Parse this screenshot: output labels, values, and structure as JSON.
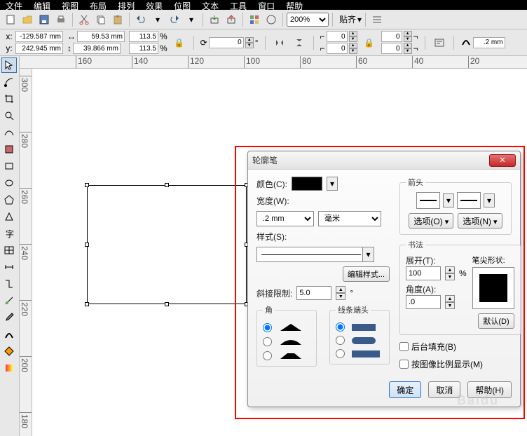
{
  "menu": {
    "items": [
      "文件",
      "编辑",
      "视图",
      "布局",
      "排列",
      "效果",
      "位图",
      "文本",
      "工具",
      "窗口",
      "帮助"
    ]
  },
  "toolbar": {
    "zoom": "200%",
    "snap_label": "贴齐"
  },
  "propbar": {
    "x_label": "x:",
    "x": "-129.587 mm",
    "y_label": "y:",
    "y": "242.945 mm",
    "w": "59.53 mm",
    "h": "39.866 mm",
    "sx": "113.5",
    "sy": "113.5",
    "rot": "0",
    "n1": "0",
    "n2": "0",
    "n3": "0",
    "n4": "0",
    "stroke": ".2 mm"
  },
  "ruler_h": [
    "160",
    "140",
    "120",
    "100",
    "80",
    "60",
    "40",
    "20"
  ],
  "ruler_v": [
    "300",
    "280",
    "260",
    "240",
    "220",
    "200",
    "180"
  ],
  "dialog": {
    "title": "轮廓笔",
    "color_label": "颜色(C):",
    "width_label": "宽度(W):",
    "width_value": ".2 mm",
    "unit": "毫米",
    "style_label": "样式(S):",
    "edit_style": "编辑样式...",
    "miter_label": "斜接限制:",
    "miter_value": "5.0",
    "corners_legend": "角",
    "caps_legend": "线条端头",
    "arrows_legend": "箭头",
    "opts_left": "选项(O)",
    "opts_right": "选项(N)",
    "calli_legend": "书法",
    "stretch_label": "展开(T):",
    "stretch_value": "100",
    "pct": "%",
    "angle_label": "角度(A):",
    "angle_value": ".0",
    "nib_label": "笔尖形状:",
    "default_btn": "默认(D)",
    "chk_fill": "后台填充(B)",
    "chk_scale": "按图像比例显示(M)",
    "ok": "确定",
    "cancel": "取消",
    "help": "帮助(H)"
  }
}
